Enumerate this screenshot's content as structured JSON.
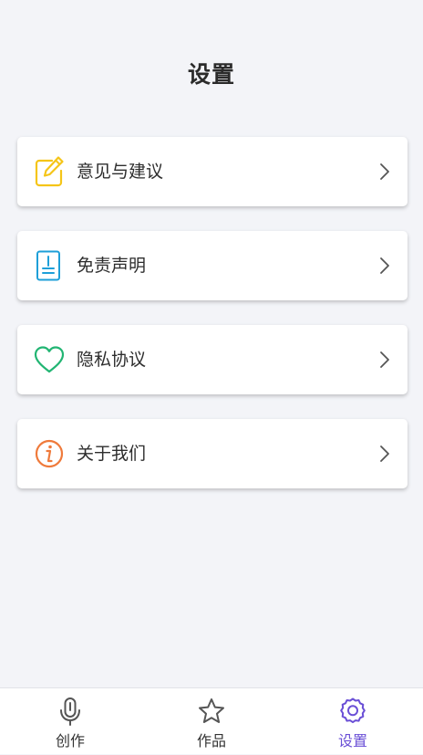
{
  "header": {
    "title": "设置"
  },
  "menu": {
    "items": [
      {
        "label": "意见与建议",
        "icon": "edit-icon",
        "color": "#f5c518"
      },
      {
        "label": "免责声明",
        "icon": "document-icon",
        "color": "#1e9fd8"
      },
      {
        "label": "隐私协议",
        "icon": "heart-icon",
        "color": "#22b573"
      },
      {
        "label": "关于我们",
        "icon": "info-icon",
        "color": "#ef7a3b"
      }
    ]
  },
  "tabbar": {
    "tabs": [
      {
        "label": "创作",
        "icon": "microphone-icon"
      },
      {
        "label": "作品",
        "icon": "star-icon"
      },
      {
        "label": "设置",
        "icon": "settings-icon",
        "active": true
      }
    ],
    "active_color": "#6a4fd6"
  }
}
